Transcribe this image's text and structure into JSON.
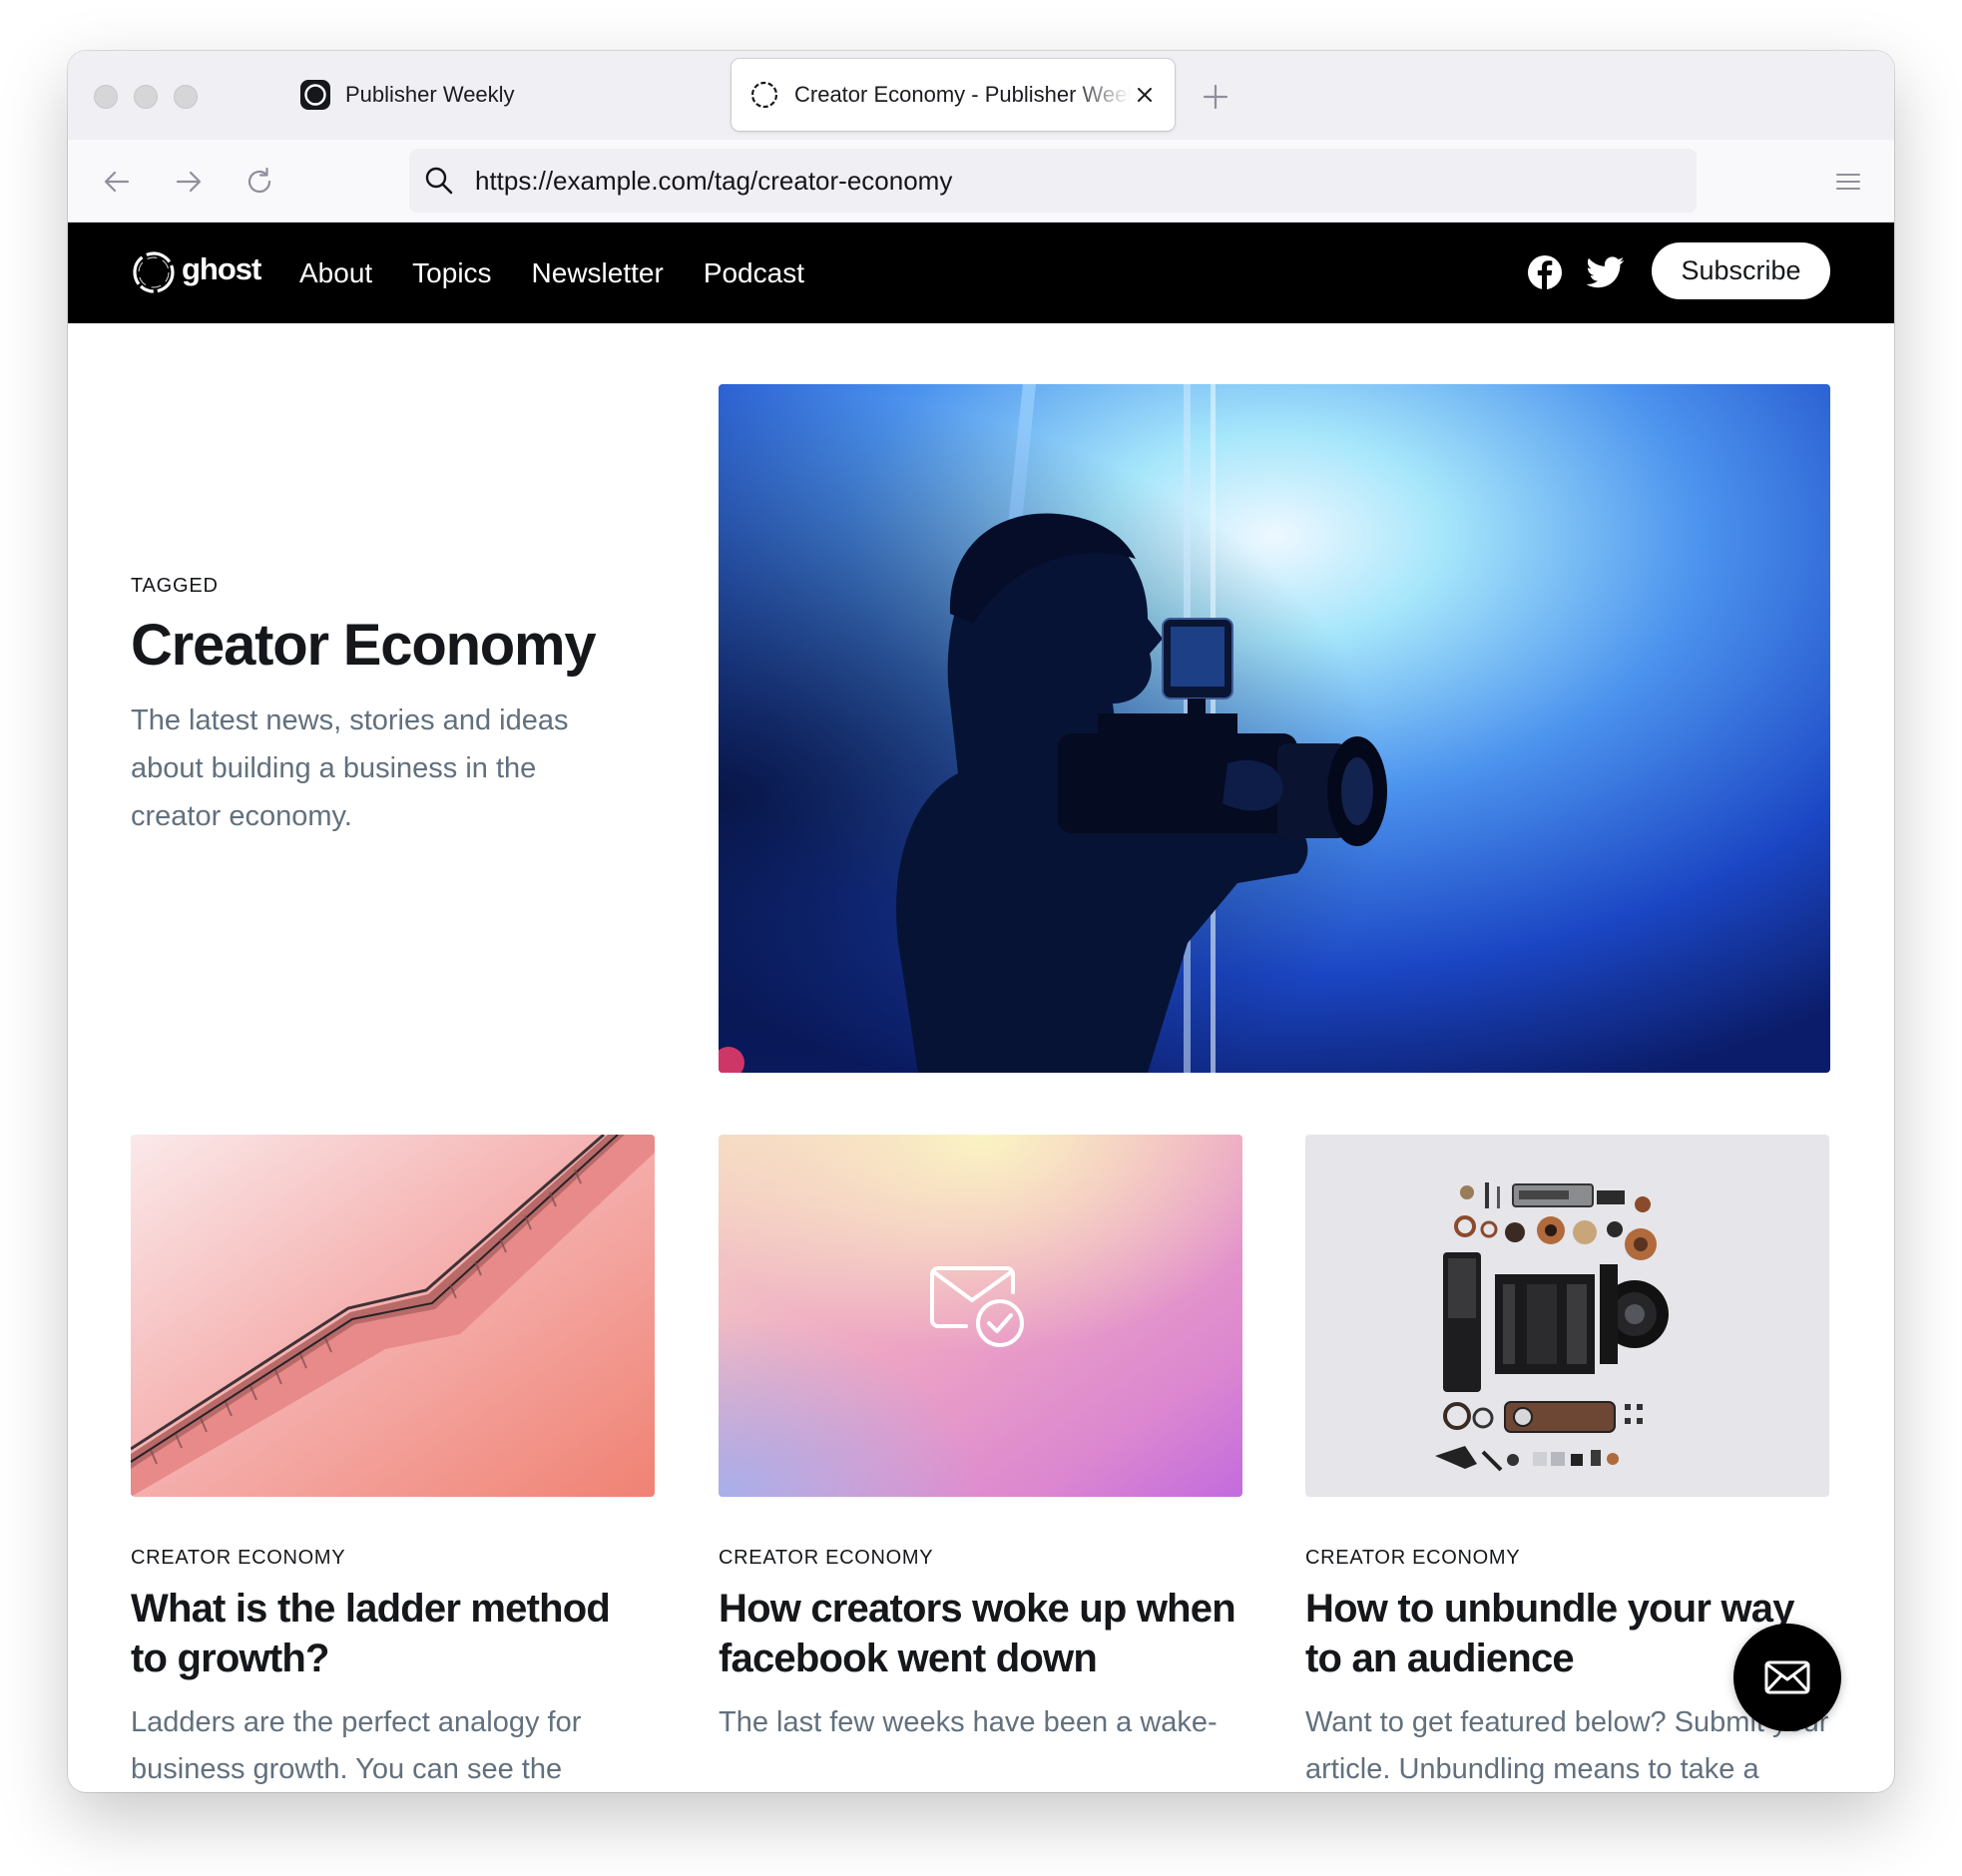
{
  "browser": {
    "tabs": [
      {
        "title": "Publisher Weekly",
        "active": false
      },
      {
        "title": "Creator Economy - Publisher Weekly",
        "active": true
      }
    ],
    "url": "https://example.com/tag/creator-economy",
    "icons": {
      "back": "arrow-left-icon",
      "forward": "arrow-right-icon",
      "reload": "reload-icon",
      "search": "search-icon",
      "menu": "hamburger-menu-icon",
      "new_tab": "plus-icon",
      "close": "close-icon"
    }
  },
  "site": {
    "logo_text": "ghost",
    "nav": [
      "About",
      "Topics",
      "Newsletter",
      "Podcast"
    ],
    "social": [
      "facebook-icon",
      "twitter-icon"
    ],
    "subscribe_label": "Subscribe",
    "colors": {
      "header_bg": "#000000",
      "text": "#15171a",
      "muted": "#62707d"
    }
  },
  "tag_page": {
    "label": "TAGGED",
    "title": "Creator Economy",
    "description": "The latest news, stories and ideas about building a business in the creator economy."
  },
  "posts": [
    {
      "tag": "CREATOR ECONOMY",
      "title": "What is the ladder method to growth?",
      "excerpt": "Ladders are the perfect analogy for business growth. You can see the"
    },
    {
      "tag": "CREATOR ECONOMY",
      "title": "How creators woke up when facebook went down",
      "excerpt": "The last few weeks have been a wake-"
    },
    {
      "tag": "CREATOR ECONOMY",
      "title": "How to unbundle your way to an audience",
      "excerpt": "Want to get featured below? Submit your article. Unbundling means to take a"
    }
  ],
  "fab_icon": "envelope-icon"
}
